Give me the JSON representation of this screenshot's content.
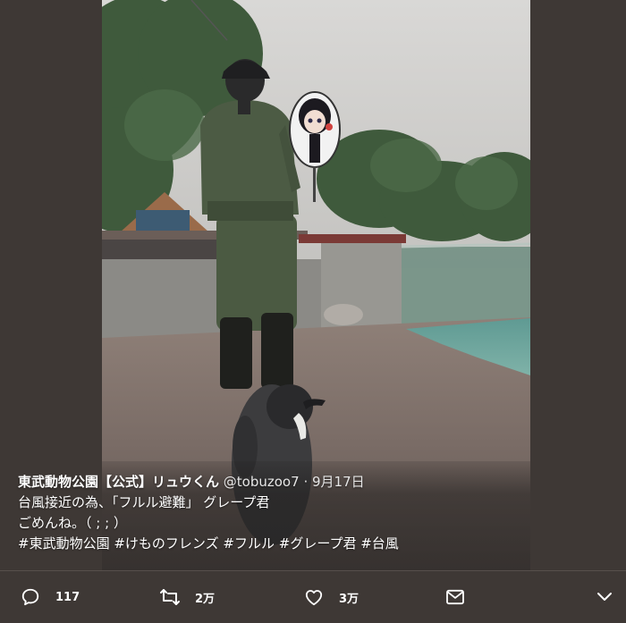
{
  "tweet": {
    "author_name": "東武動物公園【公式】リュウくん",
    "handle": "@tobuzoo7",
    "separator": "·",
    "date": "9月17日",
    "text_line1": "台風接近の為、「フルル避難」 グレープ君",
    "text_line2": "ごめんね。（ ; ; ）",
    "hashtags": [
      "#東武動物公園",
      "#けものフレンズ",
      "#フルル",
      "#グレープ君",
      "#台風"
    ]
  },
  "actions": {
    "reply_count": "117",
    "retweet_count": "2万",
    "like_count": "3万"
  },
  "icons": {
    "reply": "reply-icon",
    "retweet": "retweet-icon",
    "like": "heart-icon",
    "dm": "mail-icon",
    "more": "chevron-down-icon"
  },
  "colors": {
    "background": "#3e3835",
    "text": "#ffffff"
  }
}
